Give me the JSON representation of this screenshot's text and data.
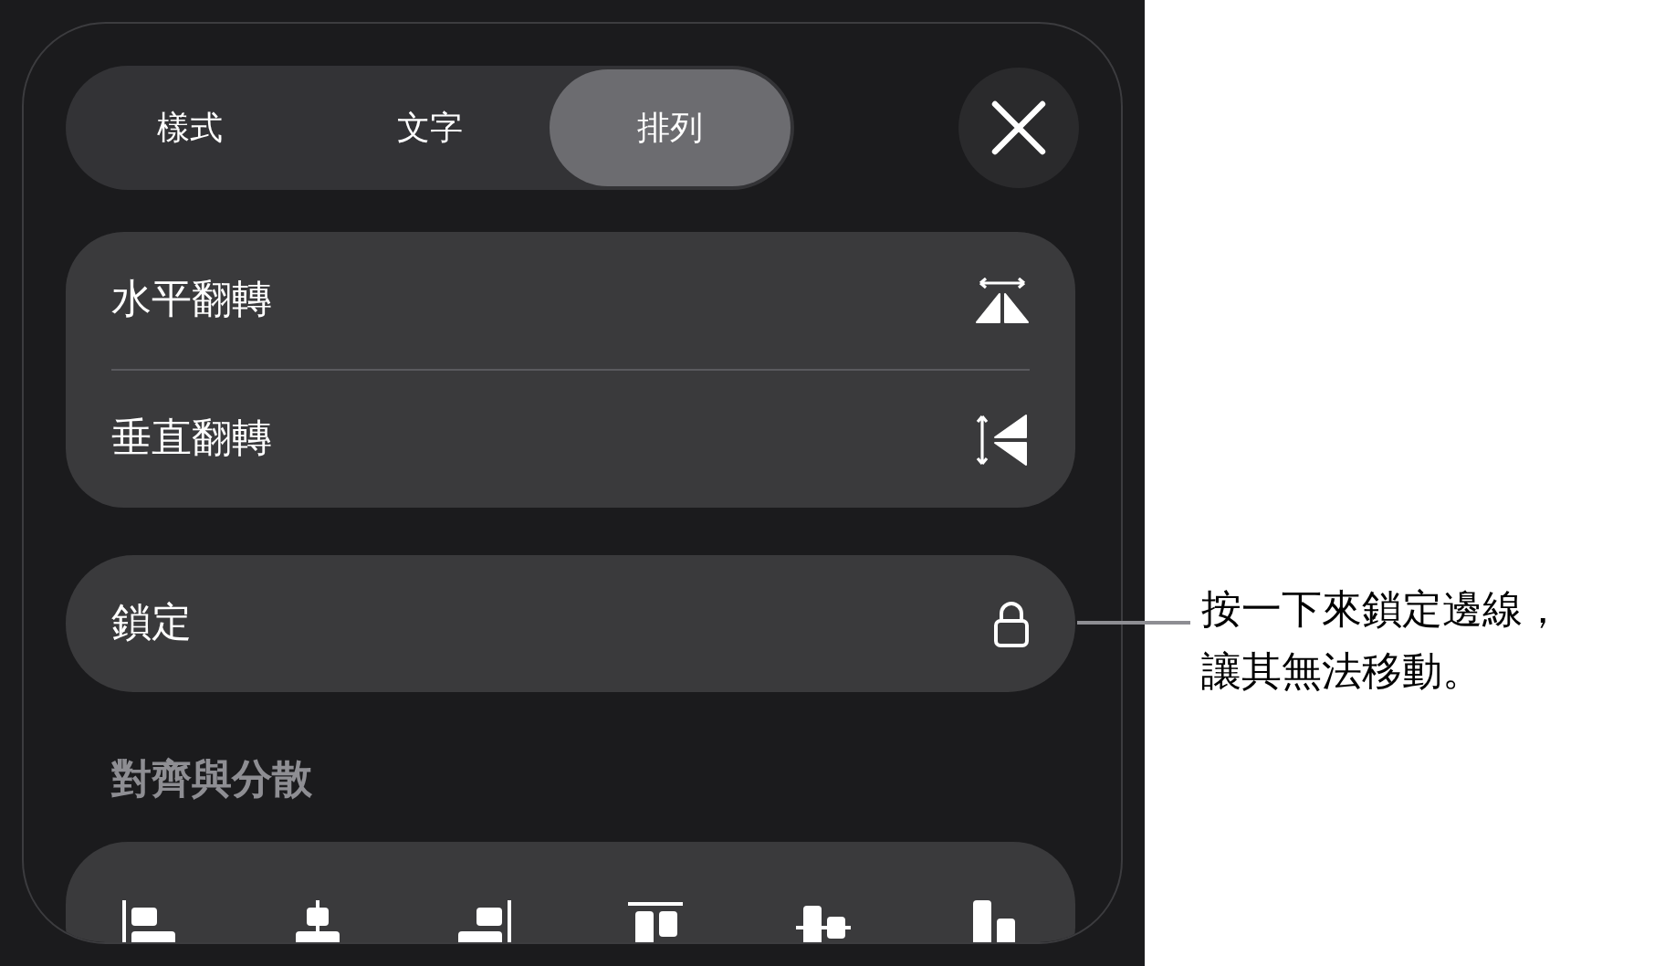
{
  "tabs": [
    {
      "label": "樣式",
      "selected": false
    },
    {
      "label": "文字",
      "selected": false
    },
    {
      "label": "排列",
      "selected": true
    }
  ],
  "flip_options": [
    {
      "label": "水平翻轉",
      "kind": "horizontal"
    },
    {
      "label": "垂直翻轉",
      "kind": "vertical"
    }
  ],
  "lock": {
    "label": "鎖定"
  },
  "align_section": {
    "heading": "對齊與分散",
    "buttons": [
      {
        "kind": "left"
      },
      {
        "kind": "center"
      },
      {
        "kind": "right"
      },
      {
        "kind": "top"
      },
      {
        "kind": "middle"
      },
      {
        "kind": "bottom"
      }
    ]
  },
  "callout": {
    "lines": [
      "按一下來鎖定邊線，",
      "讓其無法移動。"
    ]
  }
}
